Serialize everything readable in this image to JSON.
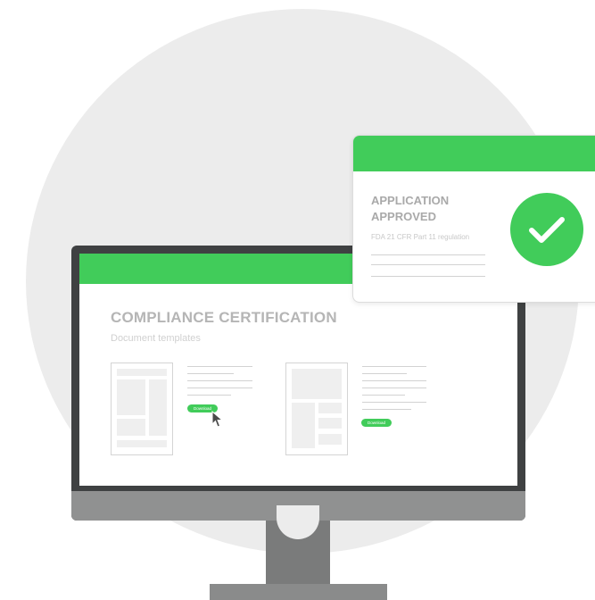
{
  "colors": {
    "accent": "#41cc5a",
    "monitor": "#3f4142",
    "background_circle": "#ececec"
  },
  "screen": {
    "title": "COMPLIANCE CERTIFICATION",
    "subtitle": "Document templates",
    "templates": [
      {
        "download_label": "Download"
      },
      {
        "download_label": "Download"
      }
    ]
  },
  "card": {
    "title": "APPLICATION APPROVED",
    "regulation": "FDA 21 CFR Part 11 regulation",
    "icon": "check-circle-icon"
  }
}
